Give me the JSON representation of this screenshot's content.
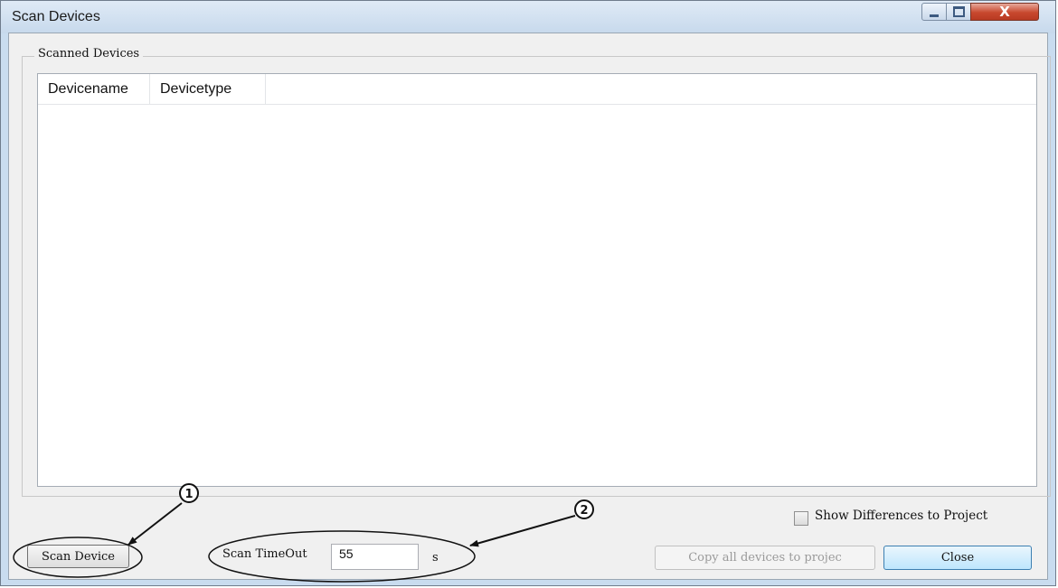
{
  "window": {
    "title": "Scan Devices",
    "controls": {
      "minimize": "minimize-icon",
      "maximize": "maximize-icon",
      "close": "close-icon"
    },
    "close_glyph": "X"
  },
  "group": {
    "label": "Scanned Devices"
  },
  "devices_table": {
    "columns": [
      "Devicename",
      "Devicetype"
    ],
    "rows": []
  },
  "show_differences": {
    "label": "Show Differences to Project",
    "checked": false
  },
  "scan_button": {
    "label": "Scan Device"
  },
  "timeout": {
    "label": "Scan TimeOut",
    "value": "55",
    "unit": "s"
  },
  "copy_button": {
    "label": "Copy all devices to projec",
    "enabled": false
  },
  "close_button": {
    "label": "Close"
  },
  "annotations": [
    {
      "number": "1"
    },
    {
      "number": "2"
    }
  ],
  "colors": {
    "accent": "#3c7fb1",
    "close_red": "#c8482e"
  }
}
